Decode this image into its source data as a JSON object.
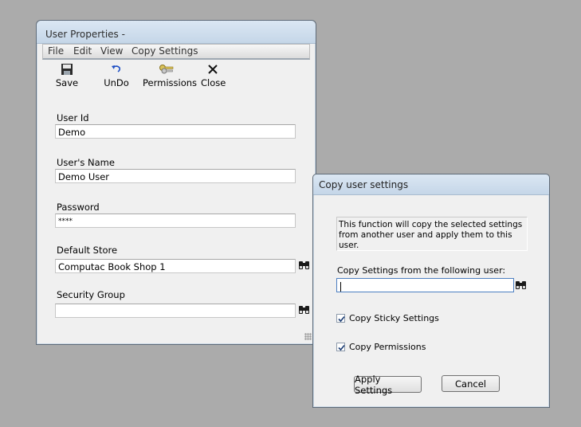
{
  "user_window": {
    "title": "User Properties -",
    "menu": [
      "File",
      "Edit",
      "View",
      "Copy Settings"
    ],
    "toolbar": {
      "save": "Save",
      "undo": "UnDo",
      "permissions": "Permissions",
      "close": "Close"
    },
    "fields": {
      "user_id": {
        "label": "User Id",
        "value": "Demo"
      },
      "users_name": {
        "label": "User's Name",
        "value": "Demo User"
      },
      "password": {
        "label": "Password",
        "value": "****"
      },
      "default_store": {
        "label": "Default Store",
        "value": "Computac Book Shop 1"
      },
      "security_group": {
        "label": "Security Group",
        "value": ""
      }
    }
  },
  "copy_dialog": {
    "title": "Copy user settings",
    "info_text": "This function will copy the selected settings from another user and apply them to this user.",
    "source_label": "Copy Settings from the following user:",
    "source_value": "",
    "copy_sticky": {
      "label": "Copy Sticky Settings",
      "checked": true
    },
    "copy_permissions": {
      "label": "Copy Permissions",
      "checked": true
    },
    "apply_button": "Apply Settings",
    "cancel_button": "Cancel"
  }
}
